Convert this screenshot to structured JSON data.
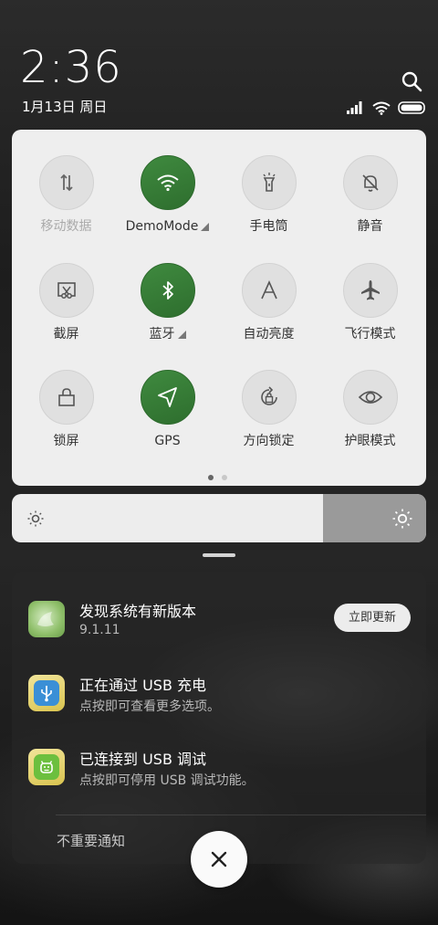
{
  "header": {
    "time": "2:36",
    "date": "1月13日 周日"
  },
  "status_icons": [
    "signal-icon",
    "wifi-icon",
    "battery-icon"
  ],
  "quick_settings": {
    "tiles": [
      {
        "label": "移动数据",
        "icon": "data-arrows-icon",
        "active": false,
        "disabled": true
      },
      {
        "label": "DemoMode",
        "icon": "wifi-icon",
        "active": true,
        "has_arrow": true
      },
      {
        "label": "手电筒",
        "icon": "flashlight-icon",
        "active": false
      },
      {
        "label": "静音",
        "icon": "bell-off-icon",
        "active": false
      },
      {
        "label": "截屏",
        "icon": "screenshot-icon",
        "active": false
      },
      {
        "label": "蓝牙",
        "icon": "bluetooth-icon",
        "active": true,
        "has_arrow": true
      },
      {
        "label": "自动亮度",
        "icon": "auto-brightness-icon",
        "active": false
      },
      {
        "label": "飞行模式",
        "icon": "airplane-icon",
        "active": false
      },
      {
        "label": "锁屏",
        "icon": "lock-icon",
        "active": false
      },
      {
        "label": "GPS",
        "icon": "location-arrow-icon",
        "active": true
      },
      {
        "label": "方向锁定",
        "icon": "rotation-lock-icon",
        "active": false
      },
      {
        "label": "护眼模式",
        "icon": "eye-icon",
        "active": false
      }
    ],
    "page_count": 2,
    "current_page": 1
  },
  "brightness": {
    "level": 0.75,
    "colors": {
      "track": "#ededed",
      "rest": "#9a9a9a"
    }
  },
  "notifications": {
    "items": [
      {
        "title": "发现系统有新版本",
        "sub": "9.1.11",
        "icon": "system-update-icon",
        "action": "立即更新"
      },
      {
        "title": "正在通过 USB 充电",
        "sub": "点按即可查看更多选项。",
        "icon": "usb-icon"
      },
      {
        "title": "已连接到 USB 调试",
        "sub": "点按即可停用 USB 调试功能。",
        "icon": "android-debug-icon"
      }
    ],
    "unimportant_label": "不重要通知"
  },
  "colors": {
    "accent_on": "#3a7f3a",
    "panel_bg": "#eeeeee"
  }
}
